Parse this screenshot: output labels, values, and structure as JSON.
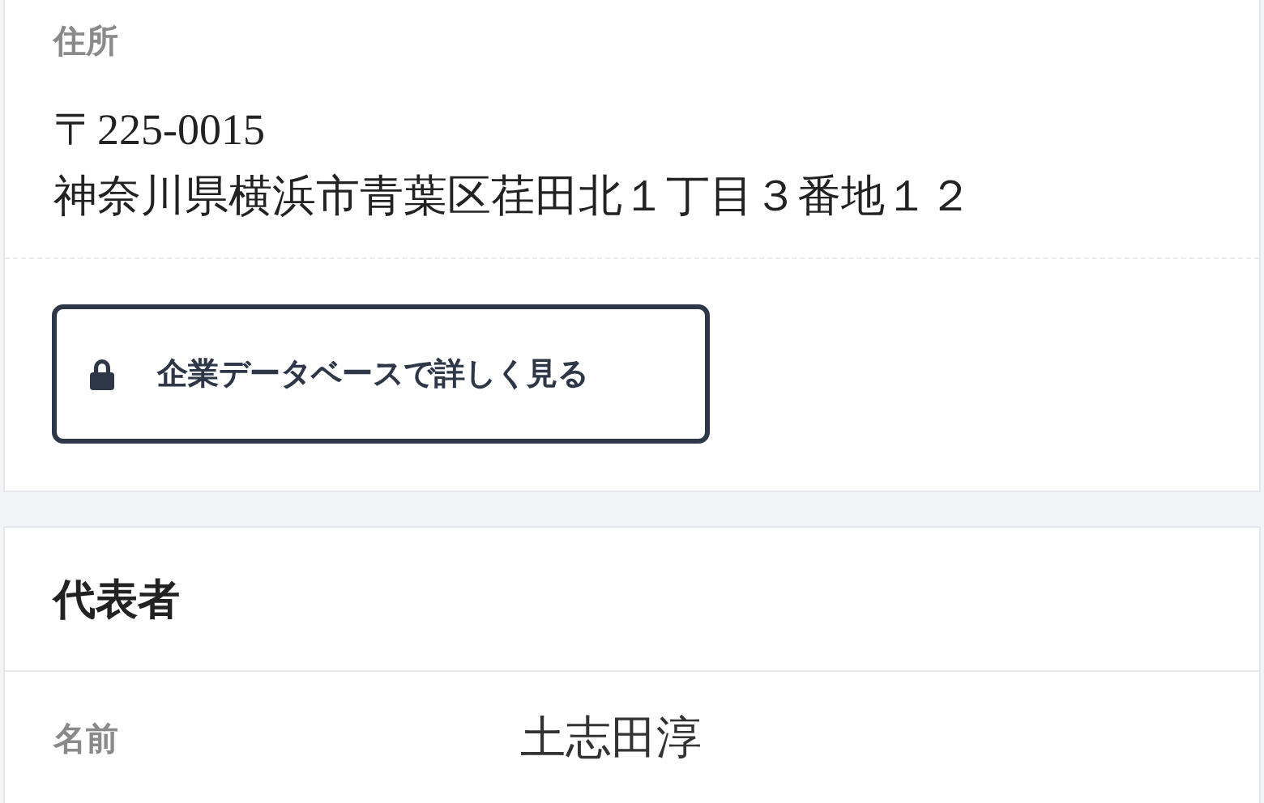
{
  "address_section": {
    "label": "住所",
    "lines": [
      "〒225-0015",
      "神奈川県横浜市青葉区荏田北１丁目３番地１２"
    ],
    "button": {
      "label": "企業データベースで詳しく見る"
    }
  },
  "representative": {
    "title": "代表者",
    "fields": [
      {
        "label": "名前",
        "value": "土志田淳"
      }
    ]
  }
}
